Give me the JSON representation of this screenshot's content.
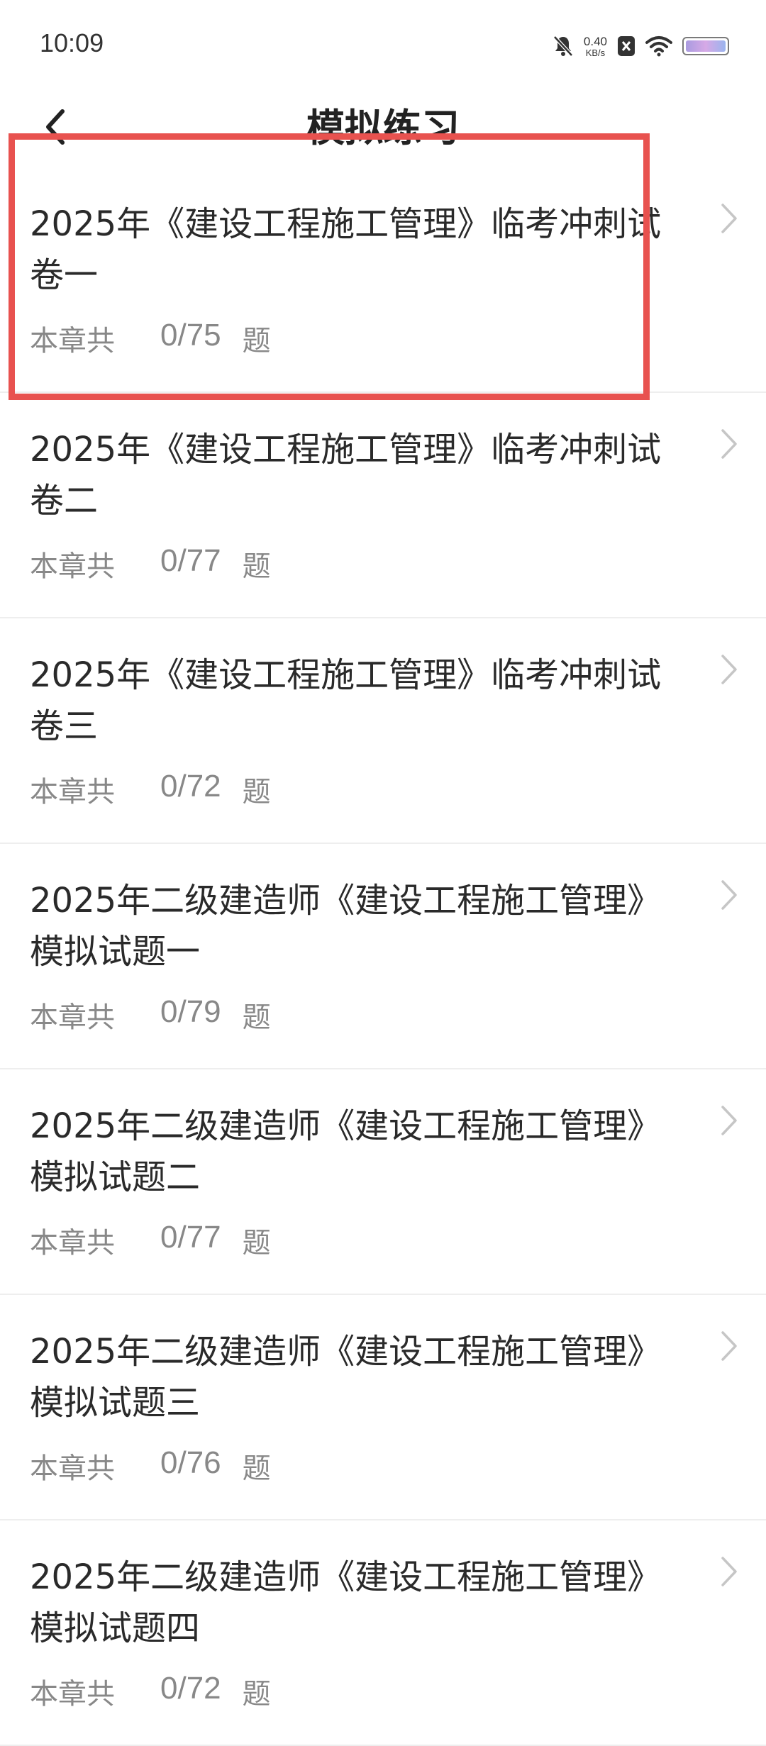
{
  "status_bar": {
    "time": "10:09",
    "net_speed_value": "0.40",
    "net_speed_unit": "KB/s"
  },
  "header": {
    "title": "模拟练习"
  },
  "items": [
    {
      "title": "2025年《建设工程施工管理》临考冲刺试卷一",
      "prefix": "本章共",
      "count": "0/75",
      "suffix": "题"
    },
    {
      "title": "2025年《建设工程施工管理》临考冲刺试卷二",
      "prefix": "本章共",
      "count": "0/77",
      "suffix": "题"
    },
    {
      "title": "2025年《建设工程施工管理》临考冲刺试卷三",
      "prefix": "本章共",
      "count": "0/72",
      "suffix": "题"
    },
    {
      "title": "2025年二级建造师《建设工程施工管理》模拟试题一",
      "prefix": "本章共",
      "count": "0/79",
      "suffix": "题"
    },
    {
      "title": "2025年二级建造师《建设工程施工管理》模拟试题二",
      "prefix": "本章共",
      "count": "0/77",
      "suffix": "题"
    },
    {
      "title": "2025年二级建造师《建设工程施工管理》模拟试题三",
      "prefix": "本章共",
      "count": "0/76",
      "suffix": "题"
    },
    {
      "title": "2025年二级建造师《建设工程施工管理》模拟试题四",
      "prefix": "本章共",
      "count": "0/72",
      "suffix": "题"
    }
  ],
  "colors": {
    "highlight": "#e8524f",
    "chevron": "#c6c6c6",
    "divider": "#eeeeee"
  },
  "icons": {
    "back": "chevron-left-icon",
    "item_arrow": "chevron-right-icon"
  }
}
